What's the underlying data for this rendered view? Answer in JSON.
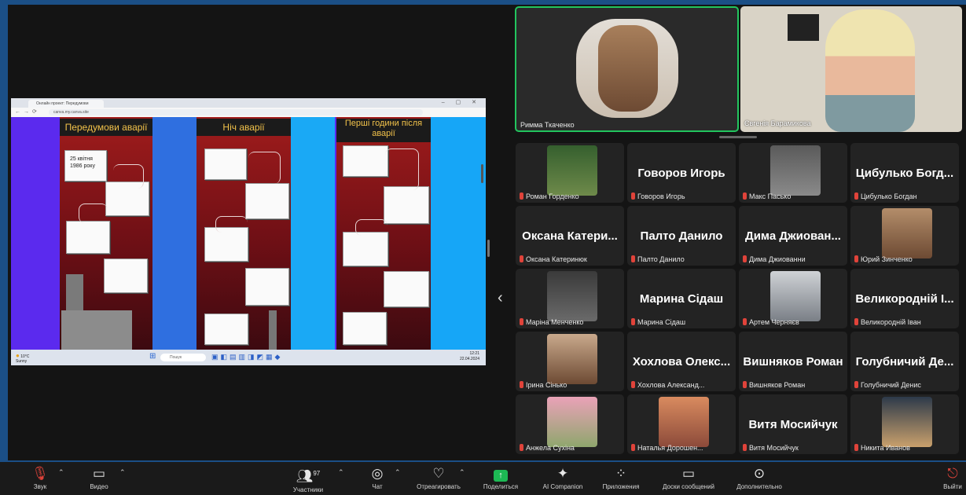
{
  "shared_screen": {
    "browser": {
      "tab_title": "Онлайн проект: Передумови",
      "url": "canva.my.canva.site",
      "window_controls": "–  ▢  ✕"
    },
    "columns": [
      {
        "header": "Передумови аварії"
      },
      {
        "header": "Ніч аварії"
      },
      {
        "header": "Перші години після аварії"
      }
    ],
    "first_note": "25 квітня 1986 року",
    "taskbar": {
      "weather_temp": "10°C",
      "weather_desc": "Sunny",
      "search_placeholder": "Пошук",
      "time": "12:21",
      "date": "22.04.2024"
    }
  },
  "participants_panel": {
    "collapse_arrow": "‹",
    "top_videos": [
      {
        "name": "Римма Ткаченко",
        "speaking": true
      },
      {
        "name": "Євгенія Барамикова",
        "speaking": false
      }
    ],
    "grid": [
      {
        "label": "Роман Горденко",
        "has_video": true,
        "big": ""
      },
      {
        "label": "Говоров Игорь",
        "has_video": false,
        "big": "Говоров Игорь"
      },
      {
        "label": "Макс Пасько",
        "has_video": true,
        "big": ""
      },
      {
        "label": "Цибулько Богдан",
        "has_video": false,
        "big": "Цибулько Богд..."
      },
      {
        "label": "Оксана Катеринюк",
        "has_video": false,
        "big": "Оксана Катери..."
      },
      {
        "label": "Палто Данило",
        "has_video": false,
        "big": "Палто Данило"
      },
      {
        "label": "Дима Джиованни",
        "has_video": false,
        "big": "Дима Джиован..."
      },
      {
        "label": "Юрий Зинченко",
        "has_video": true,
        "big": ""
      },
      {
        "label": "Марiна Менченко",
        "has_video": true,
        "big": ""
      },
      {
        "label": "Марина Сідаш",
        "has_video": false,
        "big": "Марина Сідаш"
      },
      {
        "label": "Артем Черняєв",
        "has_video": true,
        "big": ""
      },
      {
        "label": "Великородній Іван",
        "has_video": false,
        "big": "Великородній І..."
      },
      {
        "label": "Ірина Сінько",
        "has_video": true,
        "big": ""
      },
      {
        "label": "Хохлова Александ...",
        "has_video": false,
        "big": "Хохлова Олекс..."
      },
      {
        "label": "Вишняков Роман",
        "has_video": false,
        "big": "Вишняков Роман"
      },
      {
        "label": "Голубничий Денис",
        "has_video": false,
        "big": "Голубничий Де..."
      },
      {
        "label": "Анжела Сухіна",
        "has_video": true,
        "big": ""
      },
      {
        "label": "Наталья Дорошен...",
        "has_video": true,
        "big": ""
      },
      {
        "label": "Витя Мосийчук",
        "has_video": false,
        "big": "Витя Мосийчук"
      },
      {
        "label": "Никита Иванов",
        "has_video": true,
        "big": ""
      }
    ]
  },
  "toolbar": {
    "audio": "Звук",
    "video": "Видео",
    "participants": "Участники",
    "participants_count": "97",
    "chat": "Чат",
    "react": "Отреагировать",
    "share": "Поделиться",
    "ai": "AI Companion",
    "apps": "Приложения",
    "whiteboards": "Доски сообщений",
    "more": "Дополнительно",
    "leave": "Выйти"
  },
  "colors": {
    "accent_green": "#22c55e",
    "mute_red": "#e0433a",
    "share_green": "#1db954"
  }
}
